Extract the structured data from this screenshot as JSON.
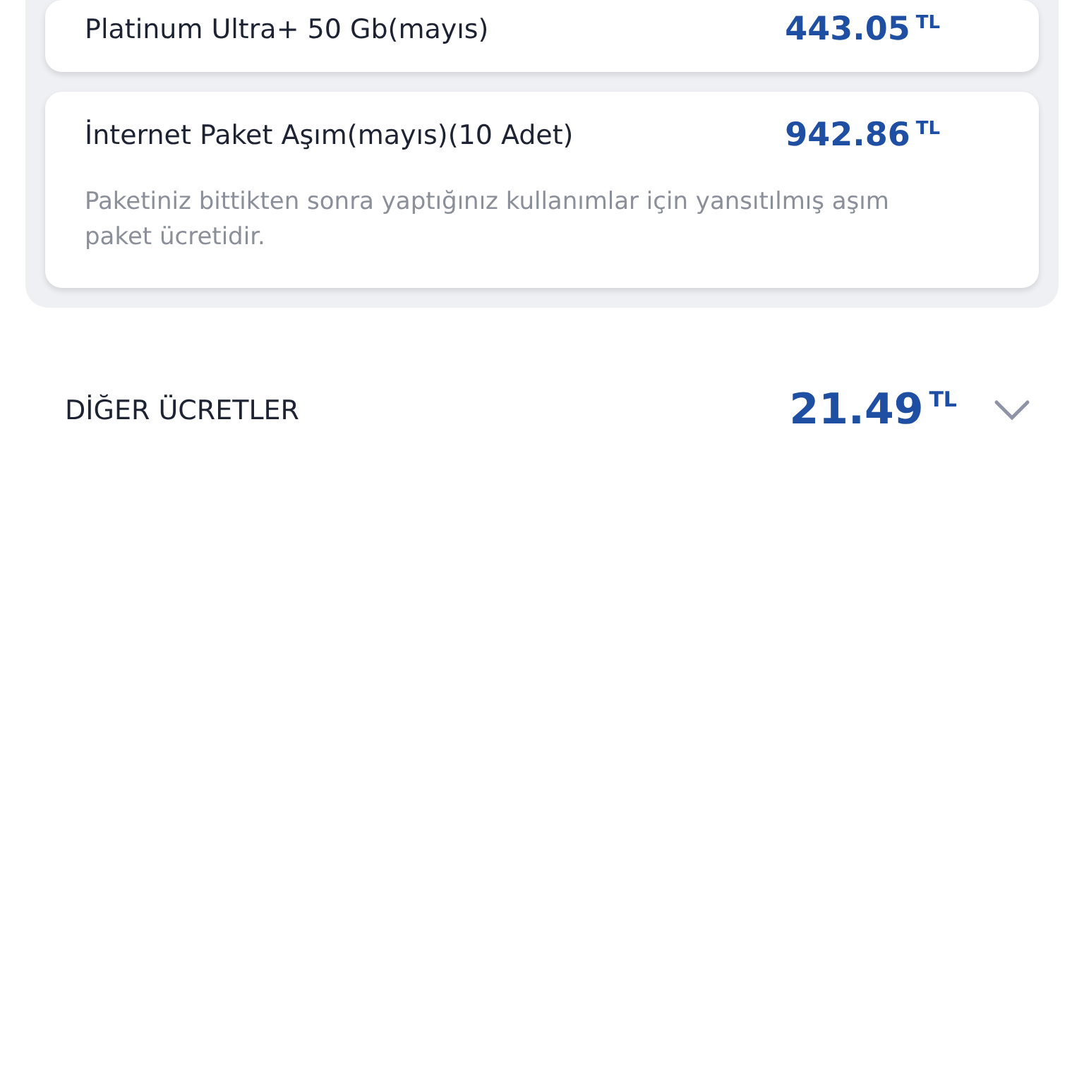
{
  "charges": [
    {
      "title": "Platinum Ultra+ 50 Gb(mayıs)",
      "amount": "443.05",
      "currency": "TL"
    },
    {
      "title": "İnternet Paket Aşım(mayıs)(10 Adet)",
      "amount": "942.86",
      "currency": "TL",
      "description": "Paketiniz bittikten sonra yaptığınız kullanımlar için yansıtılmış aşım paket ücretidir."
    }
  ],
  "other_fees": {
    "label": "DİĞER ÜCRETLER",
    "amount": "21.49",
    "currency": "TL",
    "expanded": false
  }
}
